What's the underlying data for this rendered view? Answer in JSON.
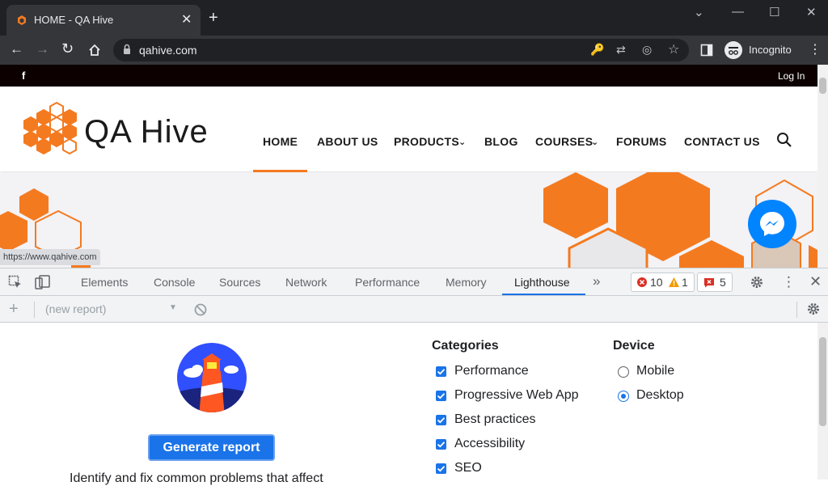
{
  "browser": {
    "tab_title": "HOME - QA Hive",
    "tab_close": "✕",
    "new_tab": "+",
    "url": "qahive.com",
    "profile": "Incognito",
    "window_controls": {
      "minimize": "—",
      "maximize": "☐",
      "close": "✕",
      "tab_search": "⌄"
    }
  },
  "site": {
    "topbar": {
      "facebook": "f",
      "login": "Log In"
    },
    "logo_text": "QA Hive",
    "nav": [
      "HOME",
      "ABOUT US",
      "PRODUCTS",
      "BLOG",
      "COURSES",
      "FORUMS",
      "CONTACT US"
    ],
    "hover_url": "https://www.qahive.com",
    "brand_color": "#f47a20"
  },
  "devtools": {
    "tabs": [
      "Elements",
      "Console",
      "Sources",
      "Network",
      "Performance",
      "Memory",
      "Lighthouse"
    ],
    "active_tab": "Lighthouse",
    "more_tabs": "»",
    "errors": "10",
    "warnings": "1",
    "issues": "5",
    "report_select": "(new report)",
    "generate_button": "Generate report",
    "description": "Identify and fix common problems that affect",
    "categories_title": "Categories",
    "categories": [
      {
        "label": "Performance",
        "checked": true
      },
      {
        "label": "Progressive Web App",
        "checked": true
      },
      {
        "label": "Best practices",
        "checked": true
      },
      {
        "label": "Accessibility",
        "checked": true
      },
      {
        "label": "SEO",
        "checked": true
      }
    ],
    "device_title": "Device",
    "devices": [
      {
        "label": "Mobile",
        "selected": false
      },
      {
        "label": "Desktop",
        "selected": true
      }
    ],
    "accent_color": "#1a73e8"
  }
}
